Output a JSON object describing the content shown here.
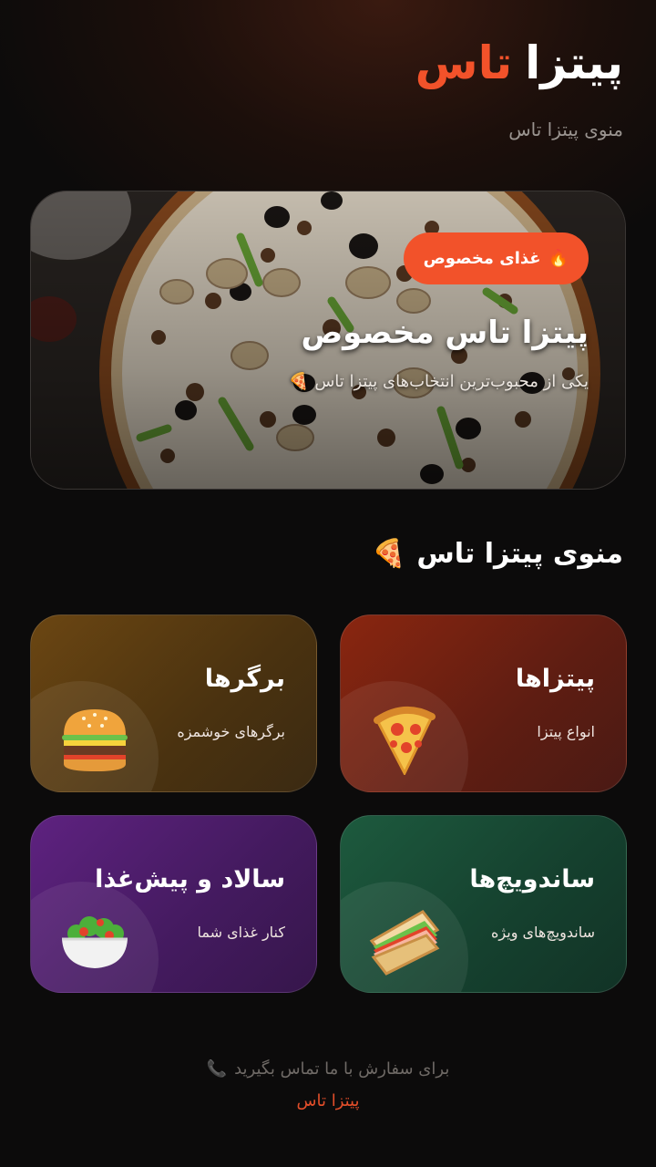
{
  "header": {
    "brand_word1": "پیتزا",
    "brand_word2": "تاس",
    "subtitle": "منوی پیتزا تاس"
  },
  "hero": {
    "badge_label": "غذای مخصوص",
    "badge_icon": "fire-icon",
    "title": "پیتزا تاس مخصوص",
    "description": "یکی از محبوب‌ترین انتخاب‌های پیتزا تاس",
    "description_icon": "pizza-icon"
  },
  "menu": {
    "title": "منوی پیتزا تاس",
    "title_icon": "pizza-icon",
    "categories": [
      {
        "title": "پیتزاها",
        "subtitle": "انواع پیتزا",
        "icon": "pizza-slice-icon",
        "color": "#8a2610"
      },
      {
        "title": "برگرها",
        "subtitle": "برگرهای خوشمزه",
        "icon": "burger-icon",
        "color": "#6b4612"
      },
      {
        "title": "ساندویچ‌ها",
        "subtitle": "ساندویچ‌های ویژه",
        "icon": "sandwich-icon",
        "color": "#1d5a3e"
      },
      {
        "title": "سالاد و پیش‌غذا",
        "subtitle": "کنار غذای شما",
        "icon": "salad-icon",
        "color": "#5e2280"
      }
    ]
  },
  "footer": {
    "contact_text": "برای سفارش با ما تماس بگیرید",
    "contact_icon": "phone-icon",
    "brand_link": "پیتزا تاس"
  },
  "colors": {
    "accent": "#f2522a",
    "background": "#0c0b0b"
  }
}
